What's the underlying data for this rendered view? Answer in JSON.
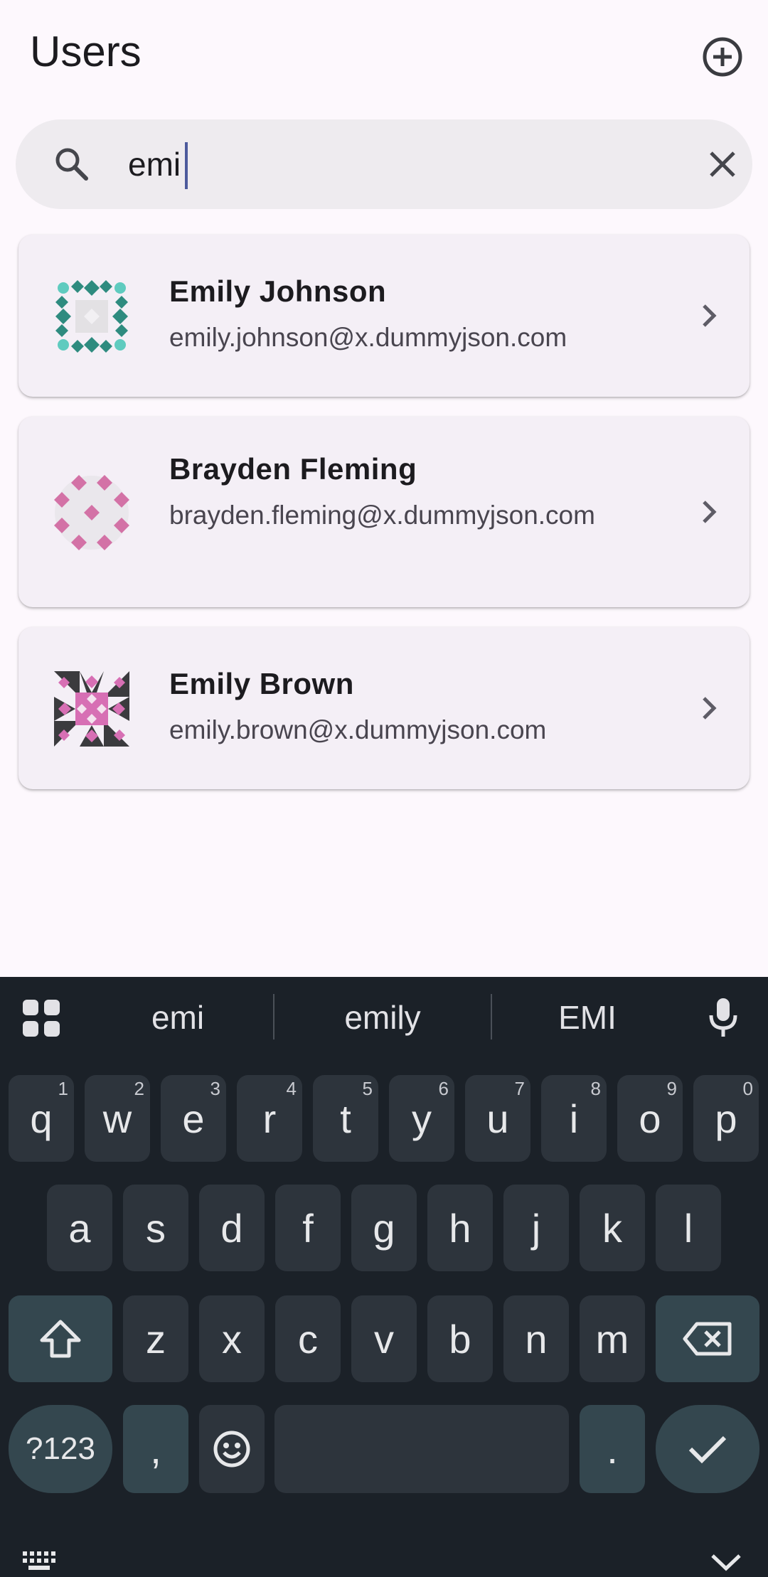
{
  "header": {
    "title": "Users"
  },
  "search": {
    "query": "emi"
  },
  "users": [
    {
      "name": "Emily Johnson",
      "email": "emily.johnson@x.dummyjson.com"
    },
    {
      "name": "Brayden Fleming",
      "email": "brayden.fleming@x.dummyjson.com"
    },
    {
      "name": "Emily Brown",
      "email": "emily.brown@x.dummyjson.com"
    }
  ],
  "icons": {
    "add": "add-circle-icon",
    "search": "search-icon",
    "clear": "close-icon",
    "chevron": "chevron-right-icon",
    "apps": "apps-grid-icon",
    "mic": "microphone-icon",
    "shift": "shift-icon",
    "backspace": "backspace-icon",
    "emoji": "emoji-icon",
    "enter": "checkmark-icon",
    "keyboard": "keyboard-icon",
    "hide": "chevron-down-icon"
  },
  "colors": {
    "avatar1": "#2e8b7f",
    "avatar1_light": "#5fcbbf",
    "avatar2": "#d372a6",
    "avatar3": "#d76fb4"
  },
  "keyboard": {
    "suggestions": [
      "emi",
      "emily",
      "EMI"
    ],
    "row1": [
      {
        "k": "q",
        "h": "1"
      },
      {
        "k": "w",
        "h": "2"
      },
      {
        "k": "e",
        "h": "3"
      },
      {
        "k": "r",
        "h": "4"
      },
      {
        "k": "t",
        "h": "5"
      },
      {
        "k": "y",
        "h": "6"
      },
      {
        "k": "u",
        "h": "7"
      },
      {
        "k": "i",
        "h": "8"
      },
      {
        "k": "o",
        "h": "9"
      },
      {
        "k": "p",
        "h": "0"
      }
    ],
    "row2": [
      "a",
      "s",
      "d",
      "f",
      "g",
      "h",
      "j",
      "k",
      "l"
    ],
    "row3": [
      "z",
      "x",
      "c",
      "v",
      "b",
      "n",
      "m"
    ],
    "symbols_key": "?123",
    "comma_key": ",",
    "period_key": "."
  }
}
